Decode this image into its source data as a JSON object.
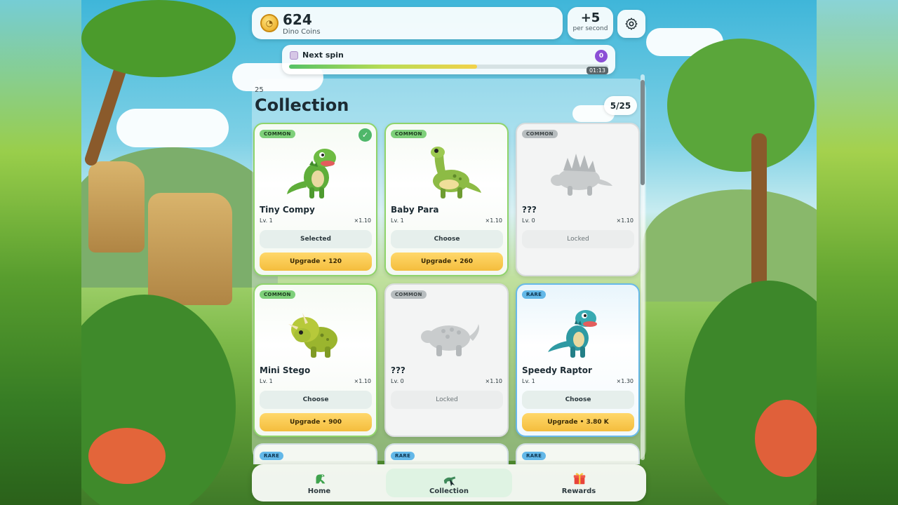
{
  "header": {
    "coins_value": "624",
    "coins_label": "Dino Coins",
    "rate_value": "+5",
    "rate_label": "per second"
  },
  "spin": {
    "label": "Next spin",
    "badge": "0",
    "timer": "01:13",
    "progress": 0.59
  },
  "collection": {
    "small_count": "25",
    "title": "Collection",
    "progress_label": "5/25",
    "cards": [
      {
        "rarity": "COMMON",
        "name": "Tiny Compy",
        "level": "Lv. 1",
        "mult": "×1.10",
        "action": "Selected",
        "upgrade": "Upgrade • 120",
        "state": "selected"
      },
      {
        "rarity": "COMMON",
        "name": "Baby Para",
        "level": "Lv. 1",
        "mult": "×1.10",
        "action": "Choose",
        "upgrade": "Upgrade • 260",
        "state": "owned"
      },
      {
        "rarity": "COMMON",
        "name": "???",
        "level": "Lv. 0",
        "mult": "×1.10",
        "action": "Locked",
        "upgrade": "",
        "state": "locked"
      },
      {
        "rarity": "COMMON",
        "name": "Mini Stego",
        "level": "Lv. 1",
        "mult": "×1.10",
        "action": "Choose",
        "upgrade": "Upgrade • 900",
        "state": "owned"
      },
      {
        "rarity": "COMMON",
        "name": "???",
        "level": "Lv. 0",
        "mult": "×1.10",
        "action": "Locked",
        "upgrade": "",
        "state": "locked"
      },
      {
        "rarity": "RARE",
        "name": "Speedy Raptor",
        "level": "Lv. 1",
        "mult": "×1.30",
        "action": "Choose",
        "upgrade": "Upgrade • 3.80 K",
        "state": "owned"
      }
    ],
    "partial_cards": [
      {
        "rarity": "RARE"
      },
      {
        "rarity": "RARE"
      },
      {
        "rarity": "RARE"
      }
    ]
  },
  "nav": {
    "home_label": "Home",
    "collection_label": "Collection",
    "rewards_label": "Rewards"
  },
  "colors": {
    "accent_green": "#4fb76a",
    "upgrade_yellow": "#f4bd3d",
    "rare_blue": "#63b8e8",
    "spin_purple": "#8b4fd6"
  }
}
